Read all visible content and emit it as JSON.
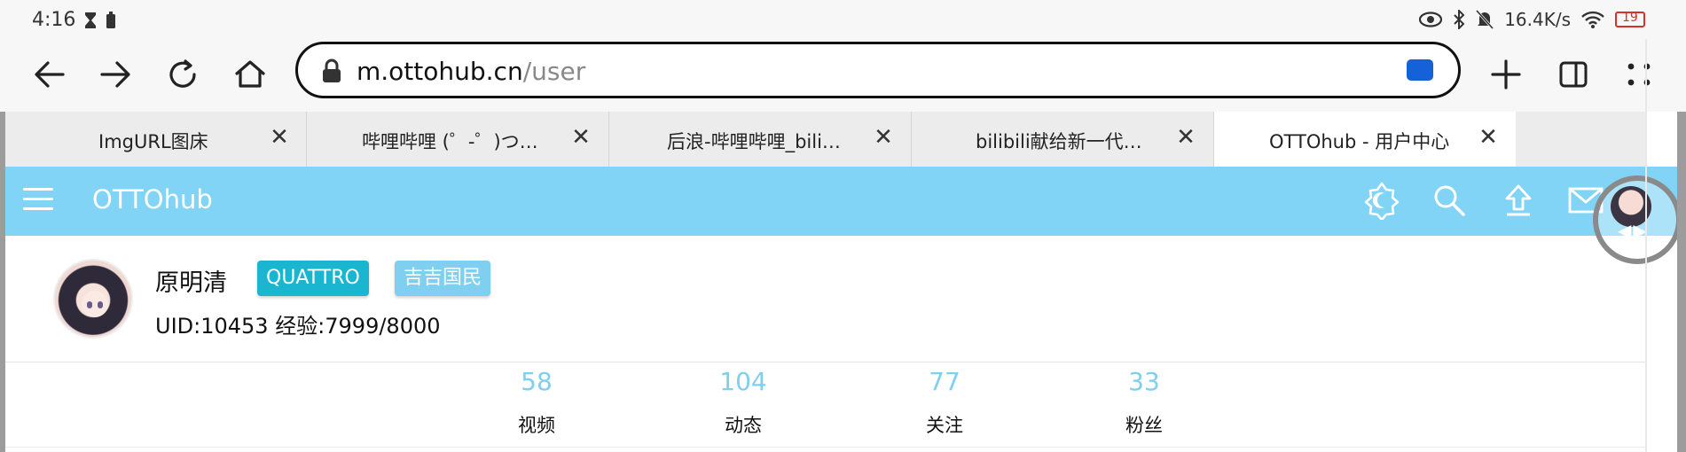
{
  "status_bar": {
    "time": "4:16",
    "left_icons": [
      "hourglass-icon",
      "battery-saver-icon"
    ],
    "right_icons": [
      "eye-icon",
      "bluetooth-icon",
      "mute-icon",
      "wifi-icon",
      "battery-icon"
    ],
    "network_speed": "16.4K/s",
    "battery_level": "19"
  },
  "toolbar": {
    "url_host": "m.ottohub.cn",
    "url_path": "/user"
  },
  "tabs": [
    {
      "title": "ImgURL图床"
    },
    {
      "title": "哔哩哔哩 (゜-゜)つ…"
    },
    {
      "title": "后浪-哔哩哔哩_bili…"
    },
    {
      "title": "bilibili献给新一代…"
    },
    {
      "title": "OTTOhub - 用户中心",
      "active": true
    }
  ],
  "tab_close_glyph": "✕",
  "appbar": {
    "title": "OTTOhub",
    "icons": [
      "theme-toggle-icon",
      "search-icon",
      "upload-icon",
      "mail-icon"
    ]
  },
  "user": {
    "name": "原明清",
    "badges": [
      "QUATTRO",
      "吉吉国民"
    ],
    "meta": "UID:10453 经验:7999/8000"
  },
  "stats": [
    {
      "value": "58",
      "label": "视频"
    },
    {
      "value": "104",
      "label": "动态"
    },
    {
      "value": "77",
      "label": "关注"
    },
    {
      "value": "33",
      "label": "粉丝"
    }
  ],
  "colors": {
    "appbar": "#81d4f5",
    "badge_primary": "#1ab6cf",
    "badge_secondary": "#7fcff0",
    "stat_value": "#7fcff0",
    "cast_icon": "#1561d8"
  }
}
